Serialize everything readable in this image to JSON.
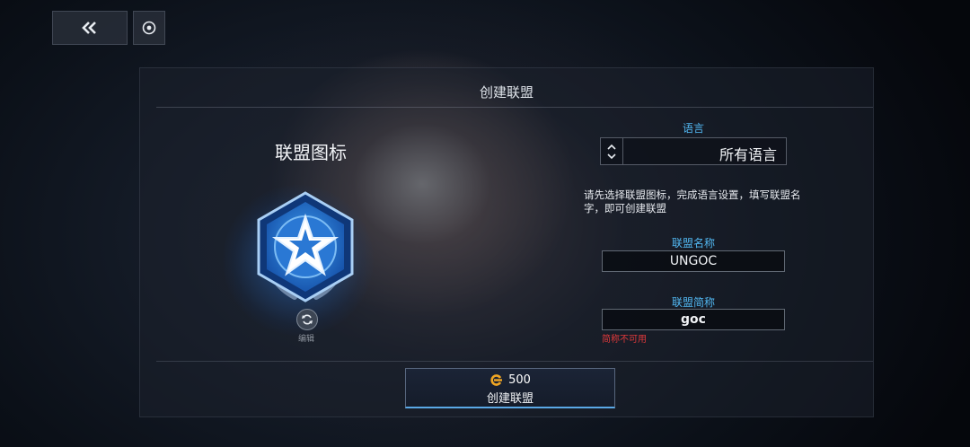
{
  "panel": {
    "title": "创建联盟"
  },
  "emblem": {
    "title": "联盟图标",
    "edit_label": "编辑"
  },
  "language": {
    "label": "语言",
    "value": "所有语言"
  },
  "hint": "请先选择联盟图标，完成语言设置，填写联盟名字，即可创建联盟",
  "name_field": {
    "label": "联盟名称",
    "value": "UNGOC"
  },
  "abbr_field": {
    "label": "联盟简称",
    "value": "goc",
    "error": "简称不可用"
  },
  "create_button": {
    "cost": "500",
    "label": "创建联盟"
  },
  "colors": {
    "accent": "#52b8f2",
    "error": "#e0393b",
    "emblem_blue": "#1f6fd1"
  }
}
